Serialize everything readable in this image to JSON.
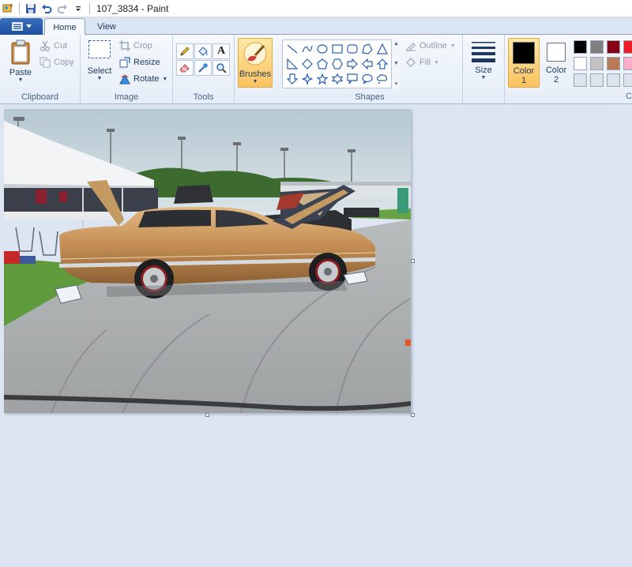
{
  "window": {
    "title": "107_3834 - Paint"
  },
  "tabs": {
    "home": "Home",
    "view": "View"
  },
  "clipboard": {
    "paste": "Paste",
    "cut": "Cut",
    "copy": "Copy",
    "group": "Clipboard"
  },
  "image": {
    "select": "Select",
    "crop": "Crop",
    "resize": "Resize",
    "rotate": "Rotate",
    "group": "Image"
  },
  "tools": {
    "group": "Tools"
  },
  "brushes": {
    "label": "Brushes"
  },
  "shapes": {
    "outline": "Outline",
    "fill": "Fill",
    "group": "Shapes"
  },
  "size": {
    "label": "Size"
  },
  "colors": {
    "color1_label": "Color",
    "color1_num": "1",
    "color2_label": "Color",
    "color2_num": "2",
    "group_partial": "C",
    "color1": "#000000",
    "color2": "#ffffff",
    "palette": [
      "#000000",
      "#7f7f7f",
      "#880015",
      "#ed1c24",
      "#ffffff",
      "#c3c3c3",
      "#b97a57",
      "#ffaec9",
      "#dde3ec",
      "#dde3ec",
      "#dde3ec",
      "#dde3ec"
    ]
  },
  "accent": {
    "ribbon_active": "#fbc25e",
    "file_tab": "#2a5fae"
  }
}
